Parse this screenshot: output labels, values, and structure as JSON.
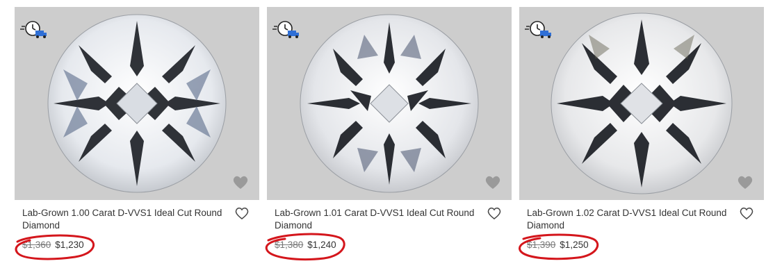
{
  "products": [
    {
      "title": "Lab-Grown 1.00 Carat D-VVS1 Ideal Cut Round Diamond",
      "old_price": "$1,360",
      "price": "$1,230",
      "shipping_icon": "fast-shipping-truck-icon",
      "wishlist_icon": "heart-outline-icon"
    },
    {
      "title": "Lab-Grown 1.01 Carat D-VVS1 Ideal Cut Round Diamond",
      "old_price": "$1,380",
      "price": "$1,240",
      "shipping_icon": "fast-shipping-truck-icon",
      "wishlist_icon": "heart-outline-icon"
    },
    {
      "title": "Lab-Grown 1.02 Carat D-VVS1 Ideal Cut Round Diamond",
      "old_price": "$1,390",
      "price": "$1,250",
      "shipping_icon": "fast-shipping-truck-icon",
      "wishlist_icon": "heart-outline-icon"
    }
  ],
  "colors": {
    "image_bg": "#cdcdcd",
    "annotation_red": "#d4161c",
    "shipping_blue": "#2f6fd6"
  }
}
